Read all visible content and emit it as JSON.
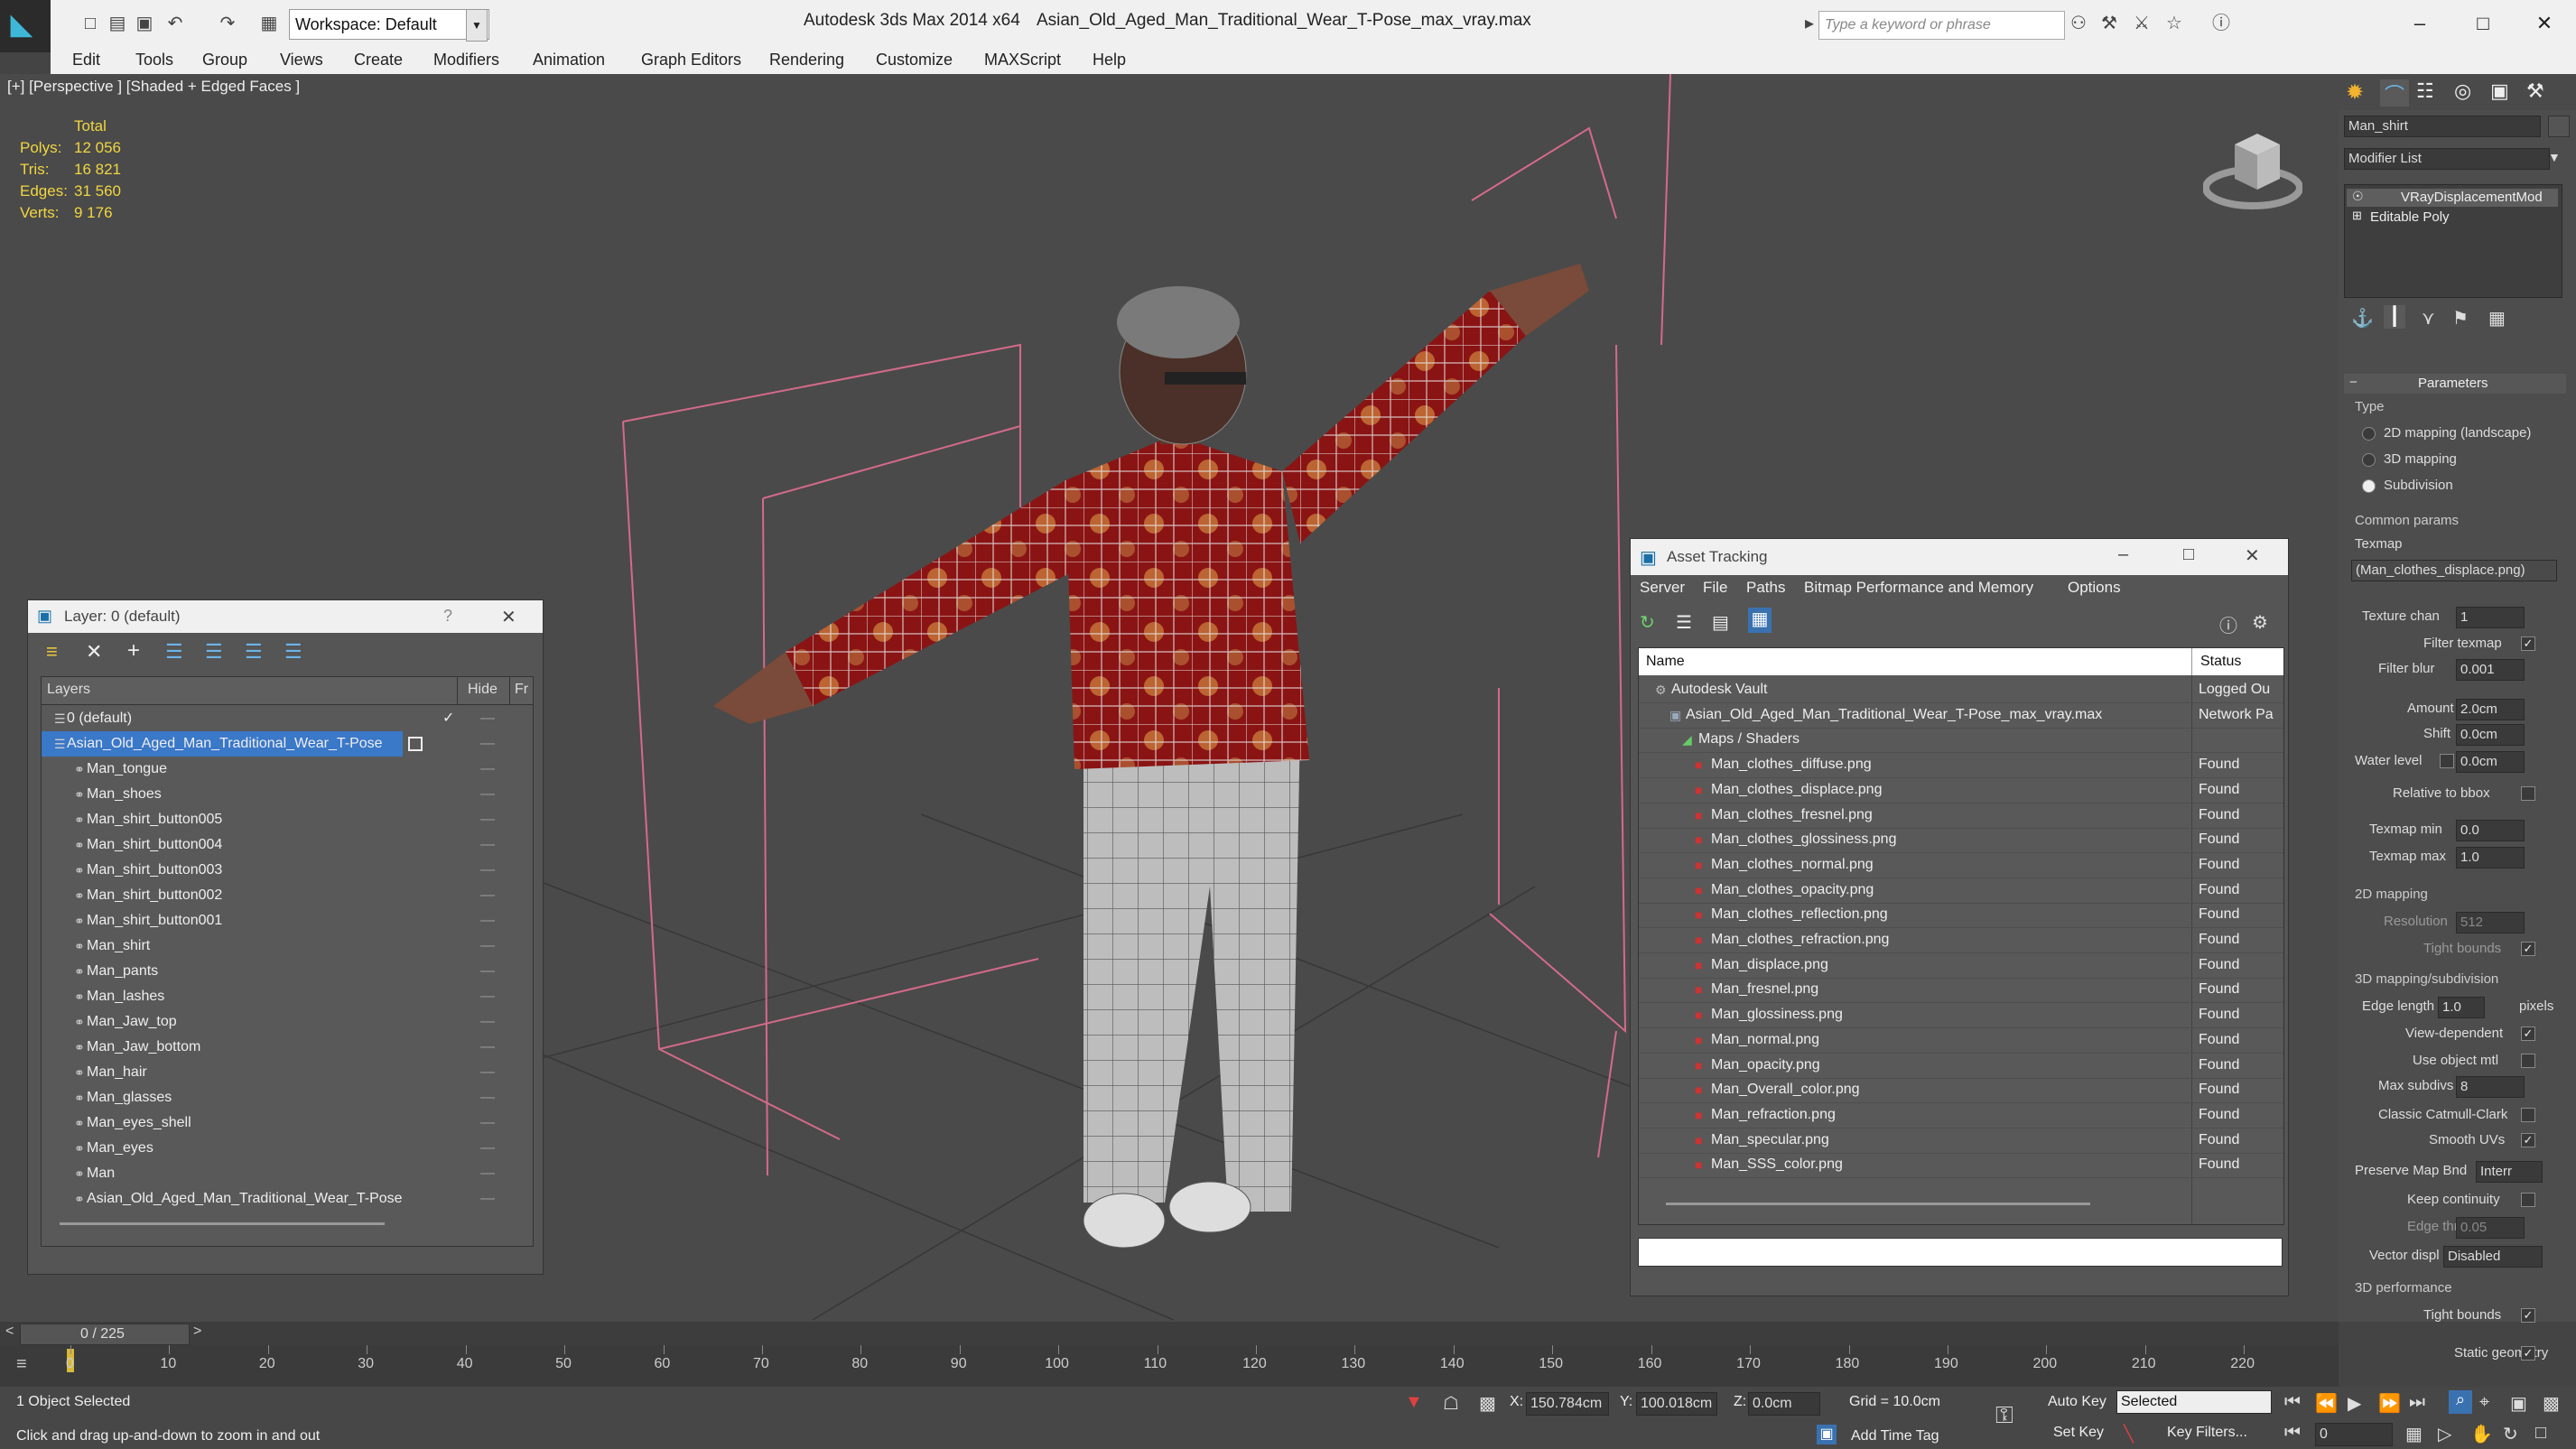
{
  "titlebar": {
    "workspace": "Workspace: Default",
    "app": "Autodesk 3ds Max  2014 x64",
    "document": "Asian_Old_Aged_Man_Traditional_Wear_T-Pose_max_vray.max",
    "search_placeholder": "Type a keyword or phrase"
  },
  "menu": [
    "Edit",
    "Tools",
    "Group",
    "Views",
    "Create",
    "Modifiers",
    "Animation",
    "Graph Editors",
    "Rendering",
    "Customize",
    "MAXScript",
    "Help"
  ],
  "viewport": {
    "label": "[+] [Perspective ] [Shaded + Edged Faces ]",
    "stats": {
      "total": "Total",
      "rows": [
        {
          "k": "Polys:",
          "v": "12 056"
        },
        {
          "k": "Tris:",
          "v": "16 821"
        },
        {
          "k": "Edges:",
          "v": "31 560"
        },
        {
          "k": "Verts:",
          "v": "9 176"
        }
      ]
    }
  },
  "layers": {
    "title": "Layer: 0 (default)",
    "help": "?",
    "col_layers": "Layers",
    "col_hide": "Hide",
    "col_fr": "Fr",
    "rows": [
      "0 (default)",
      "Asian_Old_Aged_Man_Traditional_Wear_T-Pose",
      "Man_tongue",
      "Man_shoes",
      "Man_shirt_button005",
      "Man_shirt_button004",
      "Man_shirt_button003",
      "Man_shirt_button002",
      "Man_shirt_button001",
      "Man_shirt",
      "Man_pants",
      "Man_lashes",
      "Man_Jaw_top",
      "Man_Jaw_bottom",
      "Man_hair",
      "Man_glasses",
      "Man_eyes_shell",
      "Man_eyes",
      "Man",
      "Asian_Old_Aged_Man_Traditional_Wear_T-Pose"
    ]
  },
  "asset": {
    "title": "Asset Tracking",
    "menu": [
      "Server",
      "File",
      "Paths",
      "Bitmap Performance and Memory",
      "Options"
    ],
    "col_name": "Name",
    "col_status": "Status",
    "rows": [
      {
        "name": "Autodesk Vault",
        "status": "Logged Ou"
      },
      {
        "name": "Asian_Old_Aged_Man_Traditional_Wear_T-Pose_max_vray.max",
        "status": "Network Pa"
      },
      {
        "name": "Maps / Shaders",
        "status": ""
      },
      {
        "name": "Man_clothes_diffuse.png",
        "status": "Found"
      },
      {
        "name": "Man_clothes_displace.png",
        "status": "Found"
      },
      {
        "name": "Man_clothes_fresnel.png",
        "status": "Found"
      },
      {
        "name": "Man_clothes_glossiness.png",
        "status": "Found"
      },
      {
        "name": "Man_clothes_normal.png",
        "status": "Found"
      },
      {
        "name": "Man_clothes_opacity.png",
        "status": "Found"
      },
      {
        "name": "Man_clothes_reflection.png",
        "status": "Found"
      },
      {
        "name": "Man_clothes_refraction.png",
        "status": "Found"
      },
      {
        "name": "Man_displace.png",
        "status": "Found"
      },
      {
        "name": "Man_fresnel.png",
        "status": "Found"
      },
      {
        "name": "Man_glossiness.png",
        "status": "Found"
      },
      {
        "name": "Man_normal.png",
        "status": "Found"
      },
      {
        "name": "Man_opacity.png",
        "status": "Found"
      },
      {
        "name": "Man_Overall_color.png",
        "status": "Found"
      },
      {
        "name": "Man_refraction.png",
        "status": "Found"
      },
      {
        "name": "Man_specular.png",
        "status": "Found"
      },
      {
        "name": "Man_SSS_color.png",
        "status": "Found"
      }
    ]
  },
  "cmd": {
    "object_name": "Man_shirt",
    "modifier_list": "Modifier List",
    "stack": [
      "VRayDisplacementMod",
      "Editable Poly"
    ],
    "parameters": "Parameters",
    "type_label": "Type",
    "type_opts": [
      "2D mapping (landscape)",
      "3D mapping",
      "Subdivision"
    ],
    "common": "Common params",
    "texmap": "Texmap",
    "texmap_value": "(Man_clothes_displace.png)",
    "texture_chan": "Texture chan",
    "texture_chan_v": "1",
    "filter_texmap": "Filter texmap",
    "filter_blur": "Filter blur",
    "filter_blur_v": "0.001",
    "amount": "Amount",
    "amount_v": "2.0cm",
    "shift": "Shift",
    "shift_v": "0.0cm",
    "water_level": "Water level",
    "water_level_v": "0.0cm",
    "relative": "Relative to bbox",
    "texmap_min": "Texmap min",
    "texmap_min_v": "0.0",
    "texmap_max": "Texmap max",
    "texmap_max_v": "1.0",
    "mapping2d": "2D mapping",
    "resolution": "Resolution",
    "resolution_v": "512",
    "tight_bounds": "Tight bounds",
    "mapping3d": "3D mapping/subdivision",
    "edge_length": "Edge length",
    "edge_length_v": "1.0",
    "pixels": "pixels",
    "view_dep": "View-dependent",
    "use_obj": "Use object mtl",
    "max_subdivs": "Max subdivs",
    "max_subdivs_v": "8",
    "catmull": "Classic Catmull-Clark",
    "smooth_uvs": "Smooth UVs",
    "preserve": "Preserve Map Bnd",
    "preserve_v": "Interr",
    "keep_cont": "Keep continuity",
    "edge_thresh": "Edge thresh",
    "edge_thresh_v": "0.05",
    "vector_displ": "Vector displ",
    "vector_displ_v": "Disabled",
    "perf3d": "3D performance",
    "tight_bounds2": "Tight bounds",
    "static_geo": "Static geometry"
  },
  "timeline": {
    "frame": "0 / 225",
    "ticks": [
      "0",
      "10",
      "20",
      "30",
      "40",
      "50",
      "60",
      "70",
      "80",
      "90",
      "100",
      "110",
      "120",
      "130",
      "140",
      "150",
      "160",
      "170",
      "180",
      "190",
      "200",
      "210",
      "220"
    ]
  },
  "status": {
    "selected": "1 Object Selected",
    "hint": "Click and drag up-and-down to zoom in and out",
    "x_label": "X:",
    "x": "150.784cm",
    "y_label": "Y:",
    "y": "100.018cm",
    "z_label": "Z:",
    "z": "0.0cm",
    "grid": "Grid = 10.0cm",
    "add_time_tag": "Add Time Tag",
    "auto_key": "Auto Key",
    "selected_mode": "Selected",
    "set_key": "Set Key",
    "key_filters": "Key Filters...",
    "frame_field": "0"
  }
}
